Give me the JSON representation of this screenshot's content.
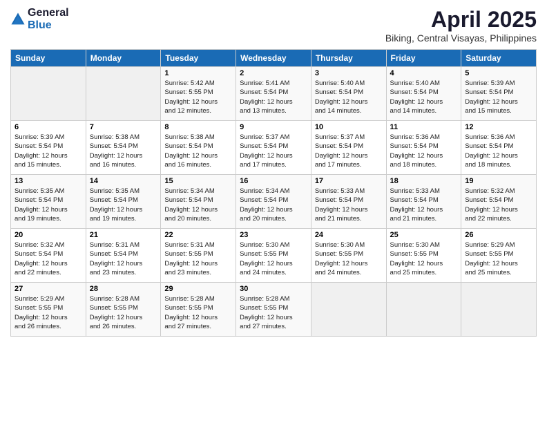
{
  "header": {
    "logo_general": "General",
    "logo_blue": "Blue",
    "main_title": "April 2025",
    "sub_title": "Biking, Central Visayas, Philippines"
  },
  "days_of_week": [
    "Sunday",
    "Monday",
    "Tuesday",
    "Wednesday",
    "Thursday",
    "Friday",
    "Saturday"
  ],
  "weeks": [
    [
      {
        "day": "",
        "info": ""
      },
      {
        "day": "",
        "info": ""
      },
      {
        "day": "1",
        "info": "Sunrise: 5:42 AM\nSunset: 5:55 PM\nDaylight: 12 hours\nand 12 minutes."
      },
      {
        "day": "2",
        "info": "Sunrise: 5:41 AM\nSunset: 5:54 PM\nDaylight: 12 hours\nand 13 minutes."
      },
      {
        "day": "3",
        "info": "Sunrise: 5:40 AM\nSunset: 5:54 PM\nDaylight: 12 hours\nand 14 minutes."
      },
      {
        "day": "4",
        "info": "Sunrise: 5:40 AM\nSunset: 5:54 PM\nDaylight: 12 hours\nand 14 minutes."
      },
      {
        "day": "5",
        "info": "Sunrise: 5:39 AM\nSunset: 5:54 PM\nDaylight: 12 hours\nand 15 minutes."
      }
    ],
    [
      {
        "day": "6",
        "info": "Sunrise: 5:39 AM\nSunset: 5:54 PM\nDaylight: 12 hours\nand 15 minutes."
      },
      {
        "day": "7",
        "info": "Sunrise: 5:38 AM\nSunset: 5:54 PM\nDaylight: 12 hours\nand 16 minutes."
      },
      {
        "day": "8",
        "info": "Sunrise: 5:38 AM\nSunset: 5:54 PM\nDaylight: 12 hours\nand 16 minutes."
      },
      {
        "day": "9",
        "info": "Sunrise: 5:37 AM\nSunset: 5:54 PM\nDaylight: 12 hours\nand 17 minutes."
      },
      {
        "day": "10",
        "info": "Sunrise: 5:37 AM\nSunset: 5:54 PM\nDaylight: 12 hours\nand 17 minutes."
      },
      {
        "day": "11",
        "info": "Sunrise: 5:36 AM\nSunset: 5:54 PM\nDaylight: 12 hours\nand 18 minutes."
      },
      {
        "day": "12",
        "info": "Sunrise: 5:36 AM\nSunset: 5:54 PM\nDaylight: 12 hours\nand 18 minutes."
      }
    ],
    [
      {
        "day": "13",
        "info": "Sunrise: 5:35 AM\nSunset: 5:54 PM\nDaylight: 12 hours\nand 19 minutes."
      },
      {
        "day": "14",
        "info": "Sunrise: 5:35 AM\nSunset: 5:54 PM\nDaylight: 12 hours\nand 19 minutes."
      },
      {
        "day": "15",
        "info": "Sunrise: 5:34 AM\nSunset: 5:54 PM\nDaylight: 12 hours\nand 20 minutes."
      },
      {
        "day": "16",
        "info": "Sunrise: 5:34 AM\nSunset: 5:54 PM\nDaylight: 12 hours\nand 20 minutes."
      },
      {
        "day": "17",
        "info": "Sunrise: 5:33 AM\nSunset: 5:54 PM\nDaylight: 12 hours\nand 21 minutes."
      },
      {
        "day": "18",
        "info": "Sunrise: 5:33 AM\nSunset: 5:54 PM\nDaylight: 12 hours\nand 21 minutes."
      },
      {
        "day": "19",
        "info": "Sunrise: 5:32 AM\nSunset: 5:54 PM\nDaylight: 12 hours\nand 22 minutes."
      }
    ],
    [
      {
        "day": "20",
        "info": "Sunrise: 5:32 AM\nSunset: 5:54 PM\nDaylight: 12 hours\nand 22 minutes."
      },
      {
        "day": "21",
        "info": "Sunrise: 5:31 AM\nSunset: 5:54 PM\nDaylight: 12 hours\nand 23 minutes."
      },
      {
        "day": "22",
        "info": "Sunrise: 5:31 AM\nSunset: 5:55 PM\nDaylight: 12 hours\nand 23 minutes."
      },
      {
        "day": "23",
        "info": "Sunrise: 5:30 AM\nSunset: 5:55 PM\nDaylight: 12 hours\nand 24 minutes."
      },
      {
        "day": "24",
        "info": "Sunrise: 5:30 AM\nSunset: 5:55 PM\nDaylight: 12 hours\nand 24 minutes."
      },
      {
        "day": "25",
        "info": "Sunrise: 5:30 AM\nSunset: 5:55 PM\nDaylight: 12 hours\nand 25 minutes."
      },
      {
        "day": "26",
        "info": "Sunrise: 5:29 AM\nSunset: 5:55 PM\nDaylight: 12 hours\nand 25 minutes."
      }
    ],
    [
      {
        "day": "27",
        "info": "Sunrise: 5:29 AM\nSunset: 5:55 PM\nDaylight: 12 hours\nand 26 minutes."
      },
      {
        "day": "28",
        "info": "Sunrise: 5:28 AM\nSunset: 5:55 PM\nDaylight: 12 hours\nand 26 minutes."
      },
      {
        "day": "29",
        "info": "Sunrise: 5:28 AM\nSunset: 5:55 PM\nDaylight: 12 hours\nand 27 minutes."
      },
      {
        "day": "30",
        "info": "Sunrise: 5:28 AM\nSunset: 5:55 PM\nDaylight: 12 hours\nand 27 minutes."
      },
      {
        "day": "",
        "info": ""
      },
      {
        "day": "",
        "info": ""
      },
      {
        "day": "",
        "info": ""
      }
    ]
  ]
}
